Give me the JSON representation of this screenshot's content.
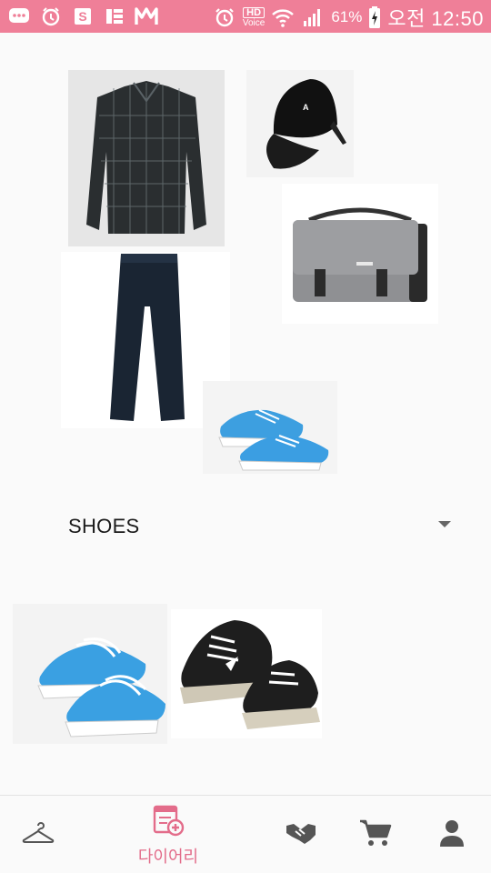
{
  "status_bar": {
    "hd_label": "HD",
    "voice_label": "Voice",
    "battery": "61%",
    "time": "오전 12:50",
    "icons": [
      "chat-bubble-icon",
      "alarm-icon",
      "s-app-icon",
      "news-icon",
      "m-app-icon",
      "alarm-clock-icon",
      "wifi-icon",
      "signal-icon",
      "battery-charging-icon"
    ]
  },
  "outfit": {
    "items": [
      {
        "name": "checked-shirt",
        "category": "top"
      },
      {
        "name": "black-cap",
        "category": "hat"
      },
      {
        "name": "gray-messenger-bag",
        "category": "bag"
      },
      {
        "name": "navy-pants",
        "category": "bottom"
      },
      {
        "name": "blue-sneakers",
        "category": "shoes"
      }
    ]
  },
  "category_select": {
    "selected": "SHOES"
  },
  "gallery": {
    "items": [
      {
        "name": "blue-sneakers"
      },
      {
        "name": "black-sneakers"
      }
    ]
  },
  "nav": {
    "items": [
      {
        "icon": "hanger-icon",
        "label": ""
      },
      {
        "icon": "diary-add-icon",
        "label": "다이어리"
      },
      {
        "icon": "handshake-icon",
        "label": ""
      },
      {
        "icon": "cart-icon",
        "label": ""
      },
      {
        "icon": "person-icon",
        "label": ""
      }
    ],
    "active_color": "#e36c8a",
    "inactive_color": "#555555"
  },
  "colors": {
    "status_bar": "#ef7f98",
    "accent": "#e36c8a",
    "background": "#fafafa"
  }
}
